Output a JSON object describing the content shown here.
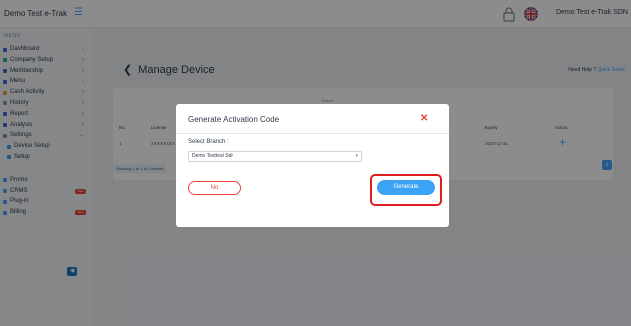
{
  "header": {
    "brand": "Demo Test e-Trak",
    "menu_toggle_icon": "hamburger-icon",
    "lock_icon": "lock-icon",
    "flag_icon": "uk-flag-icon",
    "user_name": "Demo Test e-Trak SDN"
  },
  "sidebar": {
    "menu_title": "MENU",
    "items": [
      {
        "label": "Dashboard",
        "color": "#3b6cd6"
      },
      {
        "label": "Company Setup",
        "color": "#2aa8a8"
      },
      {
        "label": "Membership",
        "color": "#3b6cd6"
      },
      {
        "label": "Menu",
        "color": "#3b6cd6"
      },
      {
        "label": "Cash Activity",
        "color": "#e8a33c"
      },
      {
        "label": "History",
        "color": "#8a94a6"
      },
      {
        "label": "Report",
        "color": "#3b6cd6"
      },
      {
        "label": "Analysis",
        "color": "#3b6cd6"
      },
      {
        "label": "Settings",
        "color": "#8a94a6"
      },
      {
        "label": "Device Setup",
        "color": "#3ba3f5"
      },
      {
        "label": "Setup",
        "color": "#3ba3f5"
      },
      {
        "label": "Promo",
        "color": "#45a5ff"
      },
      {
        "label": "CRMS",
        "color": "#45a5ff",
        "badge": "New"
      },
      {
        "label": "Plug-in",
        "color": "#45a5ff"
      },
      {
        "label": "Billing",
        "color": "#45a5ff",
        "badge": "New"
      }
    ],
    "collapse_label": "◀"
  },
  "page": {
    "back_icon": "back-arrow-icon",
    "title": "Manage Device",
    "help_prefix": "Need Help ?",
    "help_link": "Quick Guide",
    "search_label": "Search",
    "columns": [
      "No",
      "License",
      "Expiry",
      "Action"
    ],
    "row": {
      "no": "1",
      "license": "XXXXXXXX",
      "expiry": "2023-12-31",
      "action_label": "+"
    },
    "showing": "Showing 1 to 1 of 1 entries",
    "page_number": "1"
  },
  "modal": {
    "title": "Generate Activation Code",
    "close_label": "✕",
    "branch_label": "Select Branch :",
    "branch_value": "Demo Testtest Sdr",
    "no_label": "No",
    "generate_label": "Generate",
    "highlight_color": "#e01d1d",
    "accent_color": "#3ba3f5"
  }
}
